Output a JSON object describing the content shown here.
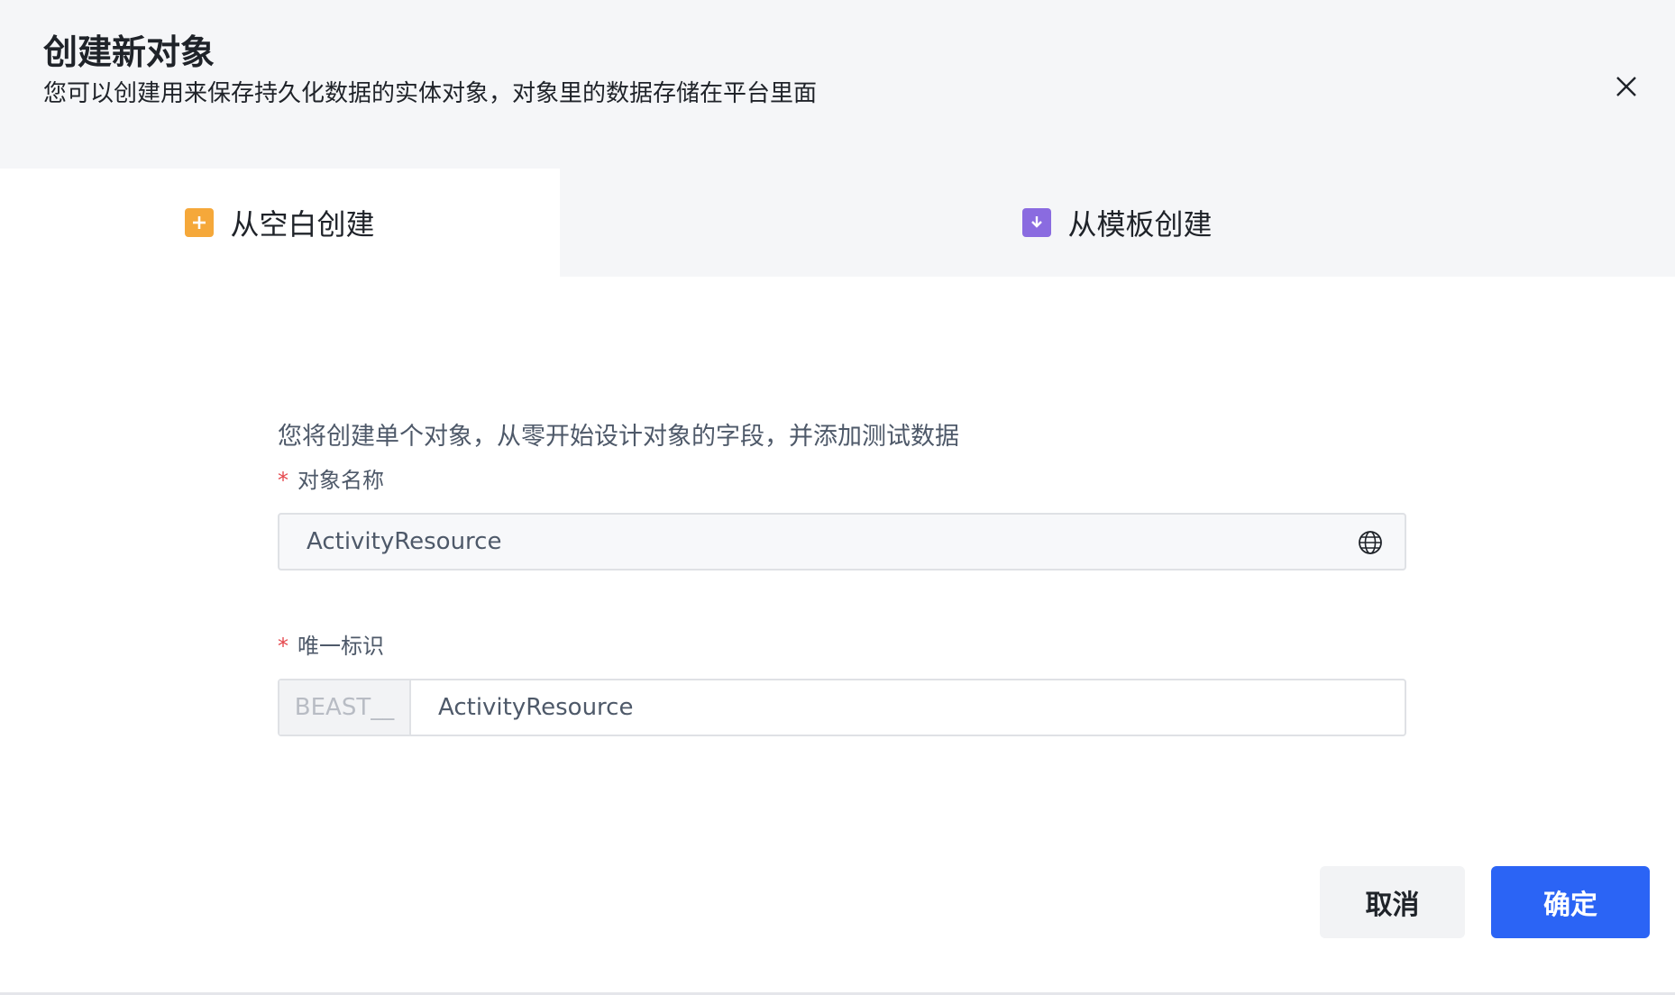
{
  "header": {
    "title": "创建新对象",
    "subtitle": "您可以创建用来保存持久化数据的实体对象，对象里的数据存储在平台里面"
  },
  "tabs": [
    {
      "label": "从空白创建",
      "icon": "plus-icon",
      "icon_color": "#f5a83a",
      "active": true
    },
    {
      "label": "从模板创建",
      "icon": "download-icon",
      "icon_color": "#8a6be0",
      "active": false
    }
  ],
  "form": {
    "description": "您将创建单个对象，从零开始设计对象的字段，并添加测试数据",
    "object_name": {
      "label": "对象名称",
      "required_mark": "*",
      "value": "ActivityResource",
      "icon": "globe-icon"
    },
    "unique_id": {
      "label": "唯一标识",
      "required_mark": "*",
      "prefix": "BEAST__",
      "value": "ActivityResource"
    }
  },
  "actions": {
    "cancel_label": "取消",
    "ok_label": "确定"
  },
  "colors": {
    "primary": "#2b64f5",
    "required": "#e5484d",
    "header_bg": "#f5f6f8"
  }
}
